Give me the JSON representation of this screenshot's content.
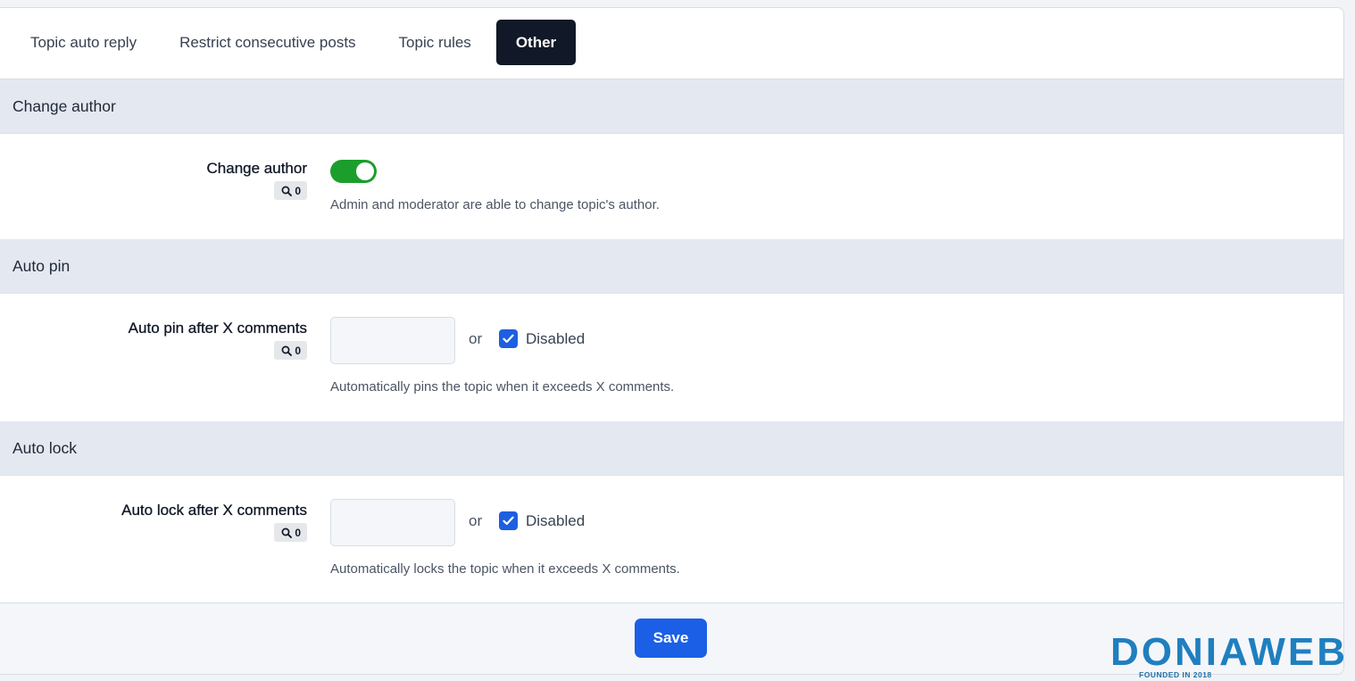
{
  "tabs": [
    {
      "label": "Topic auto reply",
      "active": false
    },
    {
      "label": "Restrict consecutive posts",
      "active": false
    },
    {
      "label": "Topic rules",
      "active": false
    },
    {
      "label": "Other",
      "active": true
    }
  ],
  "sections": {
    "change_author": {
      "header": "Change author",
      "field_label": "Change author",
      "badge_count": "0",
      "toggle_on": true,
      "help": "Admin and moderator are able to change topic's author."
    },
    "auto_pin": {
      "header": "Auto pin",
      "field_label": "Auto pin after X comments",
      "badge_count": "0",
      "input_value": "",
      "or_text": "or",
      "checkbox_label": "Disabled",
      "checkbox_checked": true,
      "help": "Automatically pins the topic when it exceeds X comments."
    },
    "auto_lock": {
      "header": "Auto lock",
      "field_label": "Auto lock after X comments",
      "badge_count": "0",
      "input_value": "",
      "or_text": "or",
      "checkbox_label": "Disabled",
      "checkbox_checked": true,
      "help": "Automatically locks the topic when it exceeds X comments."
    }
  },
  "footer": {
    "save_label": "Save"
  },
  "watermark": {
    "brand": "DONIAWEB",
    "tagline": "FOUNDED IN 2018"
  },
  "colors": {
    "active_tab_bg": "#111827",
    "toggle_on": "#1c9e2c",
    "checkbox": "#1d5fe0",
    "save_button": "#1a5fe6",
    "section_header_bg": "#e4e8f0"
  },
  "icons": {
    "badge": "search-icon",
    "checkbox": "checkmark-icon"
  }
}
